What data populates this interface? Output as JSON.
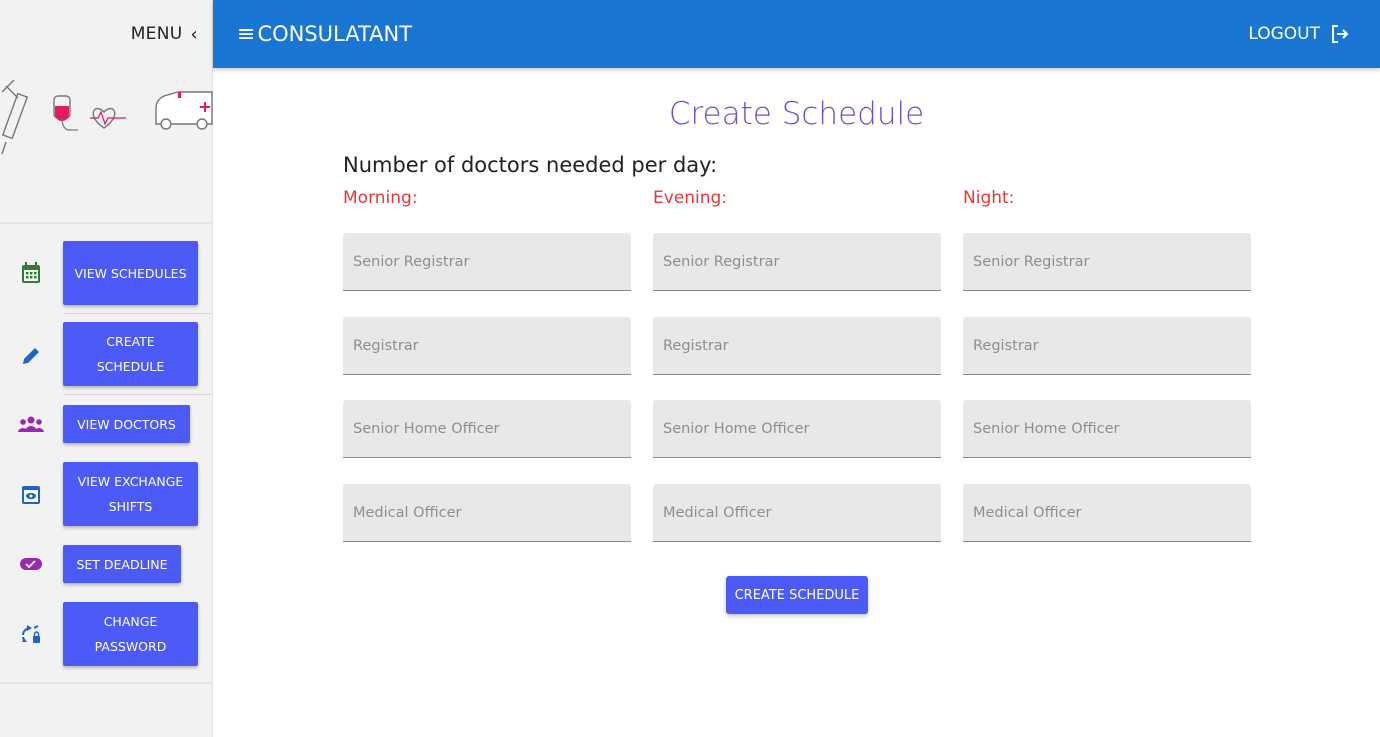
{
  "sidebar": {
    "menu_label": "MENU",
    "items": [
      {
        "label": "VIEW SCHEDULES",
        "icon": "calendar-icon",
        "color": "#2e7d32"
      },
      {
        "label": "CREATE SCHEDULE",
        "icon": "pencil-icon",
        "color": "#1e63c7"
      },
      {
        "label": "VIEW DOCTORS",
        "icon": "group-icon",
        "color": "#9c27b0"
      },
      {
        "label": "VIEW EXCHANGE SHIFTS",
        "icon": "eye-icon",
        "color": "#1e63c7"
      },
      {
        "label": "SET DEADLINE",
        "icon": "toggle-check-icon",
        "color": "#9c27b0"
      },
      {
        "label": "CHANGE PASSWORD",
        "icon": "sync-lock-icon",
        "color": "#1e63c7"
      }
    ]
  },
  "header": {
    "title": "CONSULATANT",
    "logout_label": "LOGOUT"
  },
  "main": {
    "title": "Create Schedule",
    "subtitle": "Number of doctors needed per day:",
    "columns": [
      {
        "label": "Morning:",
        "fields": [
          "Senior Registrar",
          "Registrar",
          "Senior Home Officer",
          "Medical Officer"
        ]
      },
      {
        "label": "Evening:",
        "fields": [
          "Senior Registrar",
          "Registrar",
          "Senior Home Officer",
          "Medical Officer"
        ]
      },
      {
        "label": "Night:",
        "fields": [
          "Senior Registrar",
          "Registrar",
          "Senior Home Officer",
          "Medical Officer"
        ]
      }
    ],
    "submit_label": "CREATE SCHEDULE"
  },
  "colors": {
    "topbar": "#1976d2",
    "button": "#4c5bf7",
    "title": "#6b4fd8",
    "label": "#e53935"
  }
}
